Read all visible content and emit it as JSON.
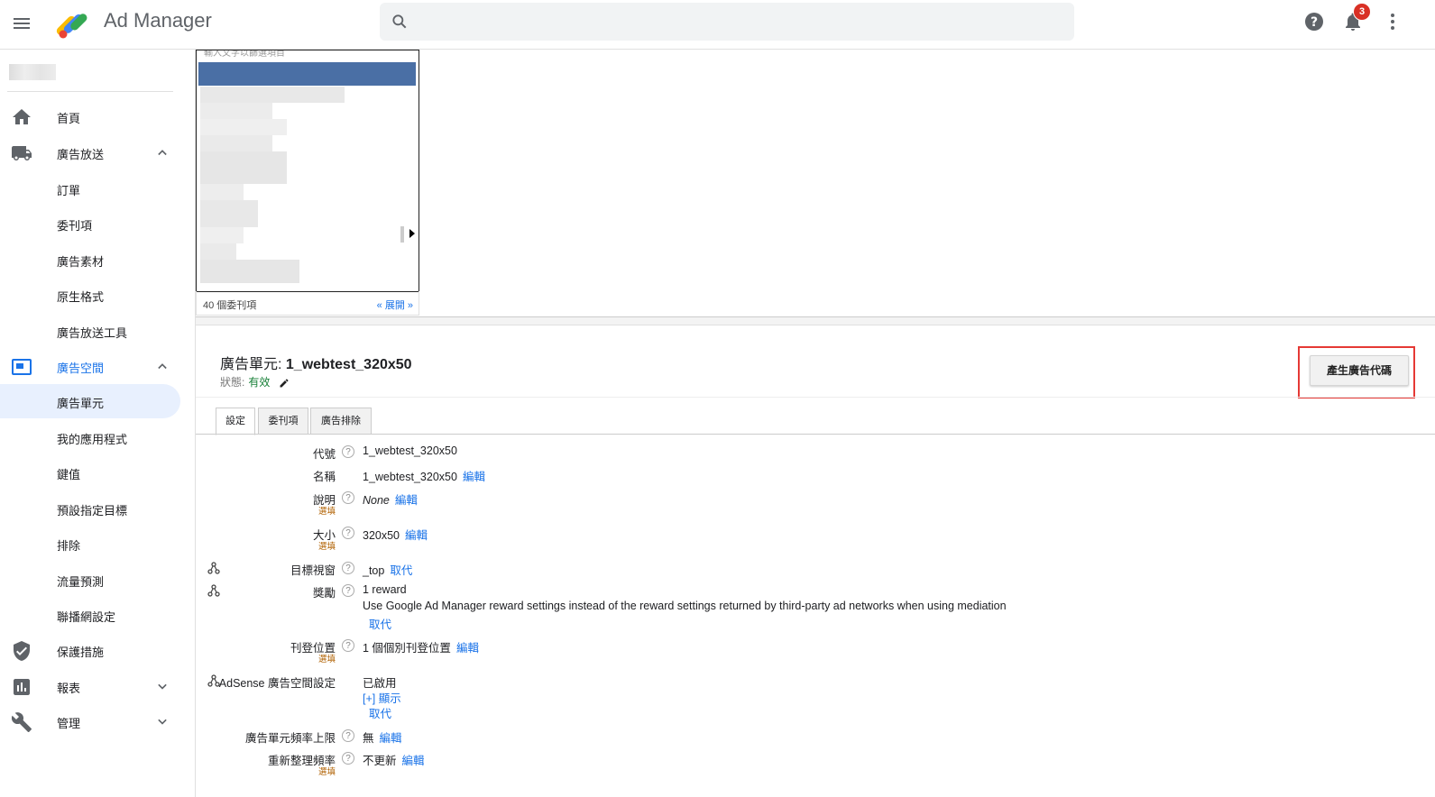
{
  "header": {
    "app_name": "Ad Manager",
    "notification_count": "3",
    "icons": [
      "menu-icon",
      "ad-manager-logo",
      "search-icon",
      "help-icon",
      "bell-icon",
      "more-vert-icon"
    ]
  },
  "sidebar": {
    "items": [
      {
        "label": "首頁",
        "icon": "home-icon"
      },
      {
        "label": "廣告放送",
        "icon": "truck-icon"
      },
      {
        "label": "訂單"
      },
      {
        "label": "委刊項"
      },
      {
        "label": "廣告素材"
      },
      {
        "label": "原生格式"
      },
      {
        "label": "廣告放送工具"
      },
      {
        "label": "廣告空間",
        "icon": "inventory-icon"
      },
      {
        "label": "廣告單元"
      },
      {
        "label": "我的應用程式"
      },
      {
        "label": "鍵值"
      },
      {
        "label": "預設指定目標"
      },
      {
        "label": "排除"
      },
      {
        "label": "流量預測"
      },
      {
        "label": "聯播網設定"
      },
      {
        "label": "保護措施",
        "icon": "shield-icon"
      },
      {
        "label": "報表",
        "icon": "chart-icon"
      },
      {
        "label": "管理",
        "icon": "wrench-icon"
      }
    ]
  },
  "picker": {
    "placeholder": "輸入文字以篩選項目",
    "count_label": "40 個委刊項",
    "expand_label": "« 展開 »"
  },
  "unit": {
    "title_prefix": "廣告單元: ",
    "title_name": "1_webtest_320x50",
    "status_label": "狀態:",
    "status_value": "有效",
    "generate_button": "產生廣告代碼"
  },
  "tabs": [
    "設定",
    "委刊項",
    "廣告排除"
  ],
  "fields": {
    "code": {
      "label": "代號",
      "value": "1_webtest_320x50"
    },
    "name": {
      "label": "名稱",
      "value": "1_webtest_320x50",
      "link": "編輯"
    },
    "desc": {
      "label": "說明",
      "optional": "選填",
      "value": "None",
      "link": "編輯"
    },
    "size": {
      "label": "大小",
      "optional": "選填",
      "value": "320x50",
      "link": "編輯"
    },
    "target_window": {
      "label": "目標視窗",
      "value": "_top",
      "link": "取代"
    },
    "reward": {
      "label": "獎勵",
      "value": "1 reward",
      "note": "Use Google Ad Manager reward settings instead of the reward settings returned by third-party ad networks when using mediation",
      "link": "取代"
    },
    "placement": {
      "label": "刊登位置",
      "optional": "選填",
      "value": "1 個個別刊登位置",
      "link": "編輯"
    },
    "adsense": {
      "label": "AdSense 廣告空間設定",
      "value": "已啟用",
      "show_link": "[+] 顯示",
      "link": "取代"
    },
    "freq_cap": {
      "label": "廣告單元頻率上限",
      "value": "無",
      "link": "編輯"
    },
    "refresh": {
      "label": "重新整理頻率",
      "optional": "選填",
      "value": "不更新",
      "link": "編輯"
    }
  },
  "help_glyph": "?",
  "colors": {
    "accent": "#1a73e8",
    "status_green": "#188038",
    "badge_red": "#d93025",
    "highlight_red": "#e53935"
  }
}
